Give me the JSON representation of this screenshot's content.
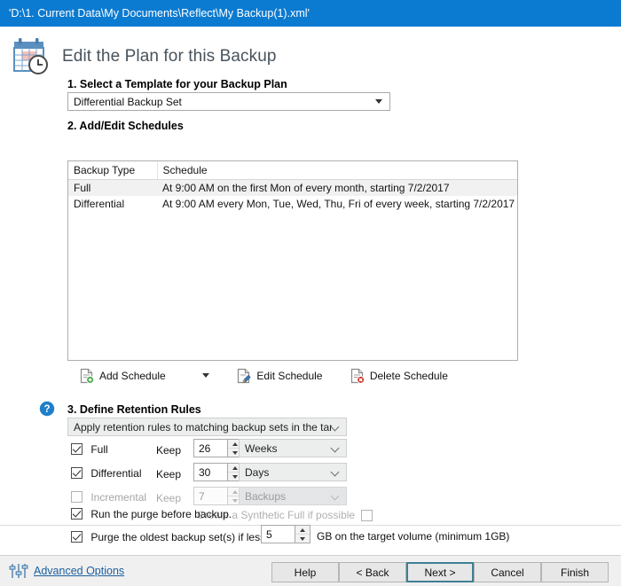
{
  "window": {
    "title": "'D:\\1. Current Data\\My Documents\\Reflect\\My Backup(1).xml'",
    "accent_color": "#0b7ad1"
  },
  "header": {
    "title": "Edit the Plan for this Backup",
    "icon": "calendar-clock-icon"
  },
  "step1": {
    "label": "1. Select a Template for your Backup Plan",
    "template_value": "Differential Backup Set"
  },
  "step2": {
    "label": "2. Add/Edit Schedules",
    "columns": [
      "Backup Type",
      "Schedule"
    ],
    "rows": [
      {
        "type": "Full",
        "schedule": "At 9:00 AM on the first Mon of every month, starting 7/2/2017",
        "selected": true
      },
      {
        "type": "Differential",
        "schedule": "At 9:00 AM every Mon, Tue, Wed, Thu, Fri of every week, starting 7/2/2017",
        "selected": false
      }
    ],
    "toolbar": {
      "add": "Add Schedule",
      "edit": "Edit Schedule",
      "delete": "Delete Schedule"
    }
  },
  "step3": {
    "label": "3. Define Retention Rules",
    "help_icon": "help-icon",
    "scope_value": "Apply retention rules to matching backup sets in the target folder",
    "keep_label": "Keep",
    "rules": [
      {
        "name": "Full",
        "checked": true,
        "enabled": true,
        "value": "26",
        "unit": "Weeks"
      },
      {
        "name": "Differential",
        "checked": true,
        "enabled": true,
        "value": "30",
        "unit": "Days"
      },
      {
        "name": "Incremental",
        "checked": false,
        "enabled": false,
        "value": "7",
        "unit": "Backups"
      }
    ],
    "synthetic_full_label": "Create a Synthetic Full if possible"
  },
  "purge": {
    "run_before_backup_label": "Run the purge before backup.",
    "run_before_backup_checked": true,
    "oldest_label": "Purge the oldest backup set(s) if less than",
    "oldest_checked": true,
    "oldest_value": "5",
    "oldest_suffix": "GB on the target volume (minimum 1GB)"
  },
  "footer": {
    "advanced_options": "Advanced Options",
    "advanced_icon": "sliders-icon",
    "buttons": [
      {
        "label": "Help",
        "focused": false
      },
      {
        "label": "< Back",
        "focused": false
      },
      {
        "label": "Next >",
        "focused": true
      },
      {
        "label": "Cancel",
        "focused": false
      },
      {
        "label": "Finish",
        "focused": false
      }
    ]
  }
}
